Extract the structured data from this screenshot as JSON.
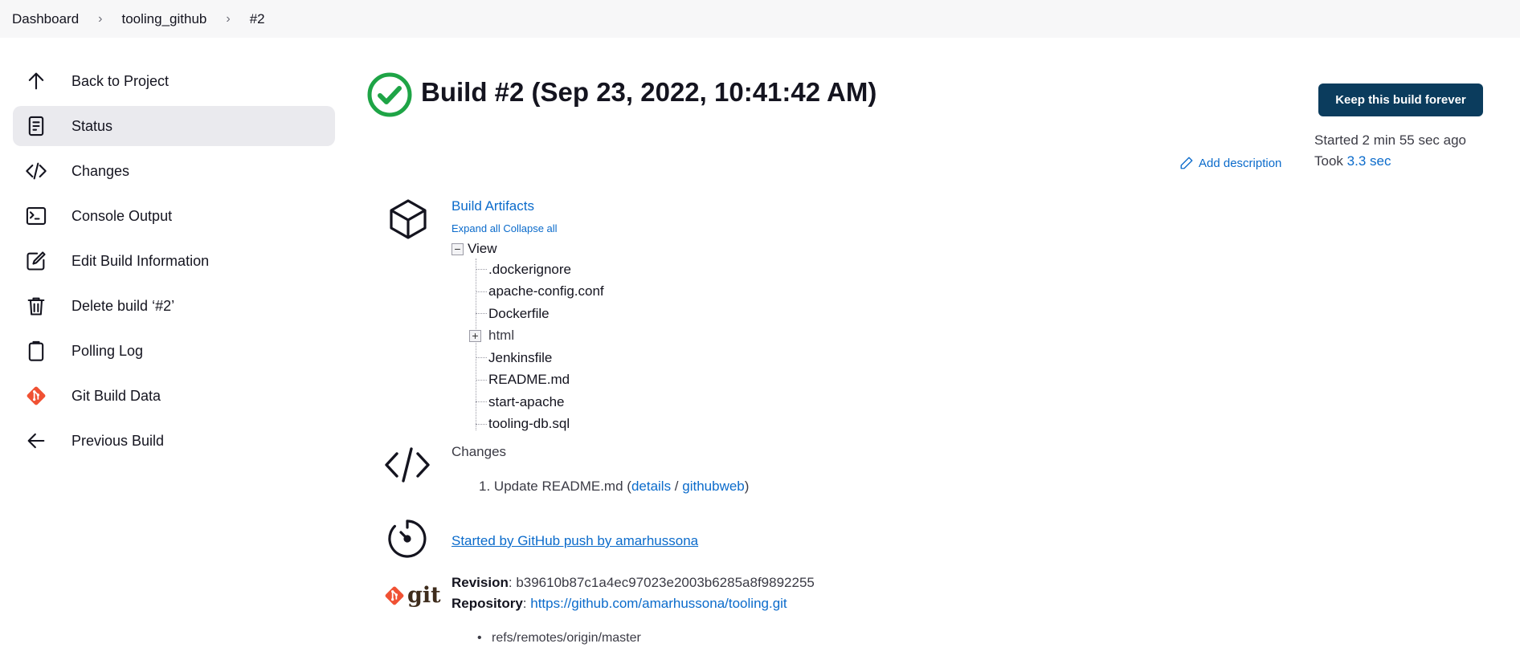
{
  "breadcrumb": {
    "items": [
      "Dashboard",
      "tooling_github",
      "#2"
    ],
    "separator": "›"
  },
  "sidebar": {
    "items": [
      {
        "label": "Back to Project",
        "icon": "arrow-up-icon"
      },
      {
        "label": "Status",
        "icon": "document-icon",
        "active": true
      },
      {
        "label": "Changes",
        "icon": "code-icon"
      },
      {
        "label": "Console Output",
        "icon": "terminal-icon"
      },
      {
        "label": "Edit Build Information",
        "icon": "edit-icon"
      },
      {
        "label": "Delete build ‘#2’",
        "icon": "trash-icon"
      },
      {
        "label": "Polling Log",
        "icon": "clipboard-icon"
      },
      {
        "label": "Git Build Data",
        "icon": "git-icon"
      },
      {
        "label": "Previous Build",
        "icon": "arrow-left-icon"
      }
    ]
  },
  "header": {
    "title": "Build #2 (Sep 23, 2022, 10:41:42 AM)",
    "status_icon": "success-check-icon",
    "keep_button": "Keep this build forever",
    "started": "Started 2 min 55 sec ago",
    "took_label": "Took ",
    "took_value": "3.3 sec",
    "add_description": "Add description"
  },
  "artifacts": {
    "title": "Build Artifacts",
    "expand_all": "Expand all",
    "collapse_all": "Collapse all",
    "root_label": "View",
    "files": [
      {
        "name": ".dockerignore",
        "folder": false
      },
      {
        "name": "apache-config.conf",
        "folder": false
      },
      {
        "name": "Dockerfile",
        "folder": false
      },
      {
        "name": "html",
        "folder": true
      },
      {
        "name": "Jenkinsfile",
        "folder": false
      },
      {
        "name": "README.md",
        "folder": false
      },
      {
        "name": "start-apache",
        "folder": false
      },
      {
        "name": "tooling-db.sql",
        "folder": false
      }
    ]
  },
  "changes": {
    "title": "Changes",
    "entries": [
      {
        "number": "1.",
        "text": "Update README.md",
        "details": "details",
        "githubweb": "githubweb"
      }
    ]
  },
  "cause": {
    "text": "Started by GitHub push by amarhussona"
  },
  "git": {
    "logo_text": "git",
    "revision_label": "Revision",
    "revision_value": "b39610b87c1a4ec97023e2003b6285a8f9892255",
    "repository_label": "Repository",
    "repository_value": "https://github.com/amarhussona/tooling.git",
    "refs": [
      "refs/remotes/origin/master"
    ]
  },
  "colors": {
    "accent_link": "#0b6bcb",
    "button_bg": "#0b3c5d",
    "success": "#1ea446",
    "git_orange": "#f05133"
  }
}
